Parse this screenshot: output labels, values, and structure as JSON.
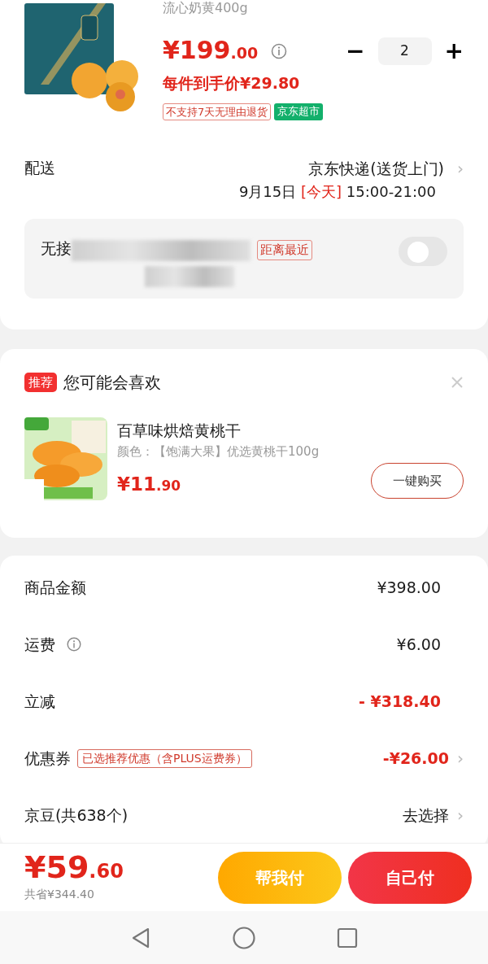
{
  "product": {
    "kind": "picture",
    "spec": "流心奶黄400g",
    "price_main": "¥199",
    "price_cents": ".00",
    "unit_price": "每件到手价¥29.80",
    "quantity": "2",
    "minus": "−",
    "plus": "+",
    "tags": [
      {
        "text": "不支持7天无理由退货",
        "kind": "outline"
      },
      {
        "text": "京东超市",
        "kind": "solid"
      }
    ]
  },
  "delivery": {
    "label": "配送",
    "method": "京东快递(送货上门)",
    "chevron": "›",
    "date": "9月15日",
    "day": "[今天]",
    "time": "15:00-21:00",
    "contactless": {
      "label": "无接",
      "tag": "距离最近",
      "on": false
    }
  },
  "recommend": {
    "badge": "推荐",
    "title": "您可能会喜欢",
    "item": {
      "kind": "picture",
      "name": "百草味烘焙黄桃干",
      "spec": "颜色：【饱满大果】优选黄桃干100g",
      "price_main": "¥11",
      "price_cents": ".90",
      "button": "一键购买"
    }
  },
  "summary": [
    {
      "label": "商品金额",
      "value": "¥398.00",
      "info": false,
      "highlight": false
    },
    {
      "label": "运费",
      "value": "¥6.00",
      "info": true,
      "highlight": false
    },
    {
      "label": "立减",
      "value": "- ¥318.40",
      "info": false,
      "highlight": true
    },
    {
      "label": "优惠券",
      "value": "-¥26.00",
      "info": false,
      "tag": "已选推荐优惠（含PLUS运费券）",
      "highlight": true,
      "chevron": "›"
    },
    {
      "label": "京豆(共638个)",
      "value": "去选择",
      "info": false,
      "highlight": false,
      "chevron": "›"
    }
  ],
  "footer": {
    "total_main": "¥59",
    "total_cents": ".60",
    "saved": "共省¥344.40",
    "buttons": [
      {
        "text": "帮我付",
        "kind": "secondary"
      },
      {
        "text": "自己付",
        "kind": "primary"
      }
    ]
  }
}
